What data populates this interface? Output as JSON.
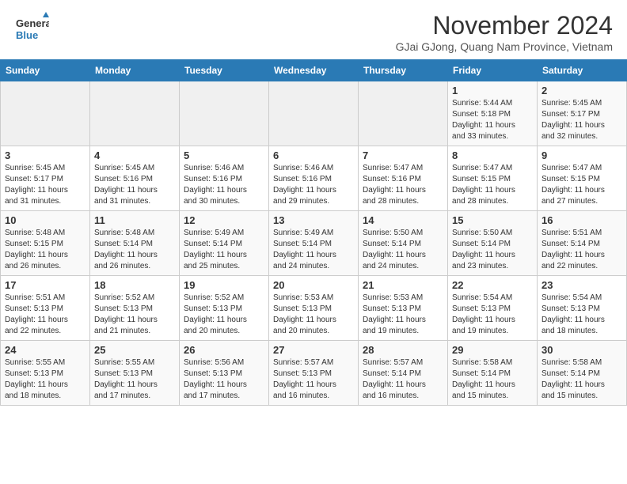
{
  "header": {
    "logo_line1": "General",
    "logo_line2": "Blue",
    "month_year": "November 2024",
    "location": "GJai GJong, Quang Nam Province, Vietnam"
  },
  "days_of_week": [
    "Sunday",
    "Monday",
    "Tuesday",
    "Wednesday",
    "Thursday",
    "Friday",
    "Saturday"
  ],
  "weeks": [
    [
      {
        "num": "",
        "info": ""
      },
      {
        "num": "",
        "info": ""
      },
      {
        "num": "",
        "info": ""
      },
      {
        "num": "",
        "info": ""
      },
      {
        "num": "",
        "info": ""
      },
      {
        "num": "1",
        "info": "Sunrise: 5:44 AM\nSunset: 5:18 PM\nDaylight: 11 hours\nand 33 minutes."
      },
      {
        "num": "2",
        "info": "Sunrise: 5:45 AM\nSunset: 5:17 PM\nDaylight: 11 hours\nand 32 minutes."
      }
    ],
    [
      {
        "num": "3",
        "info": "Sunrise: 5:45 AM\nSunset: 5:17 PM\nDaylight: 11 hours\nand 31 minutes."
      },
      {
        "num": "4",
        "info": "Sunrise: 5:45 AM\nSunset: 5:16 PM\nDaylight: 11 hours\nand 31 minutes."
      },
      {
        "num": "5",
        "info": "Sunrise: 5:46 AM\nSunset: 5:16 PM\nDaylight: 11 hours\nand 30 minutes."
      },
      {
        "num": "6",
        "info": "Sunrise: 5:46 AM\nSunset: 5:16 PM\nDaylight: 11 hours\nand 29 minutes."
      },
      {
        "num": "7",
        "info": "Sunrise: 5:47 AM\nSunset: 5:16 PM\nDaylight: 11 hours\nand 28 minutes."
      },
      {
        "num": "8",
        "info": "Sunrise: 5:47 AM\nSunset: 5:15 PM\nDaylight: 11 hours\nand 28 minutes."
      },
      {
        "num": "9",
        "info": "Sunrise: 5:47 AM\nSunset: 5:15 PM\nDaylight: 11 hours\nand 27 minutes."
      }
    ],
    [
      {
        "num": "10",
        "info": "Sunrise: 5:48 AM\nSunset: 5:15 PM\nDaylight: 11 hours\nand 26 minutes."
      },
      {
        "num": "11",
        "info": "Sunrise: 5:48 AM\nSunset: 5:14 PM\nDaylight: 11 hours\nand 26 minutes."
      },
      {
        "num": "12",
        "info": "Sunrise: 5:49 AM\nSunset: 5:14 PM\nDaylight: 11 hours\nand 25 minutes."
      },
      {
        "num": "13",
        "info": "Sunrise: 5:49 AM\nSunset: 5:14 PM\nDaylight: 11 hours\nand 24 minutes."
      },
      {
        "num": "14",
        "info": "Sunrise: 5:50 AM\nSunset: 5:14 PM\nDaylight: 11 hours\nand 24 minutes."
      },
      {
        "num": "15",
        "info": "Sunrise: 5:50 AM\nSunset: 5:14 PM\nDaylight: 11 hours\nand 23 minutes."
      },
      {
        "num": "16",
        "info": "Sunrise: 5:51 AM\nSunset: 5:14 PM\nDaylight: 11 hours\nand 22 minutes."
      }
    ],
    [
      {
        "num": "17",
        "info": "Sunrise: 5:51 AM\nSunset: 5:13 PM\nDaylight: 11 hours\nand 22 minutes."
      },
      {
        "num": "18",
        "info": "Sunrise: 5:52 AM\nSunset: 5:13 PM\nDaylight: 11 hours\nand 21 minutes."
      },
      {
        "num": "19",
        "info": "Sunrise: 5:52 AM\nSunset: 5:13 PM\nDaylight: 11 hours\nand 20 minutes."
      },
      {
        "num": "20",
        "info": "Sunrise: 5:53 AM\nSunset: 5:13 PM\nDaylight: 11 hours\nand 20 minutes."
      },
      {
        "num": "21",
        "info": "Sunrise: 5:53 AM\nSunset: 5:13 PM\nDaylight: 11 hours\nand 19 minutes."
      },
      {
        "num": "22",
        "info": "Sunrise: 5:54 AM\nSunset: 5:13 PM\nDaylight: 11 hours\nand 19 minutes."
      },
      {
        "num": "23",
        "info": "Sunrise: 5:54 AM\nSunset: 5:13 PM\nDaylight: 11 hours\nand 18 minutes."
      }
    ],
    [
      {
        "num": "24",
        "info": "Sunrise: 5:55 AM\nSunset: 5:13 PM\nDaylight: 11 hours\nand 18 minutes."
      },
      {
        "num": "25",
        "info": "Sunrise: 5:55 AM\nSunset: 5:13 PM\nDaylight: 11 hours\nand 17 minutes."
      },
      {
        "num": "26",
        "info": "Sunrise: 5:56 AM\nSunset: 5:13 PM\nDaylight: 11 hours\nand 17 minutes."
      },
      {
        "num": "27",
        "info": "Sunrise: 5:57 AM\nSunset: 5:13 PM\nDaylight: 11 hours\nand 16 minutes."
      },
      {
        "num": "28",
        "info": "Sunrise: 5:57 AM\nSunset: 5:14 PM\nDaylight: 11 hours\nand 16 minutes."
      },
      {
        "num": "29",
        "info": "Sunrise: 5:58 AM\nSunset: 5:14 PM\nDaylight: 11 hours\nand 15 minutes."
      },
      {
        "num": "30",
        "info": "Sunrise: 5:58 AM\nSunset: 5:14 PM\nDaylight: 11 hours\nand 15 minutes."
      }
    ]
  ]
}
